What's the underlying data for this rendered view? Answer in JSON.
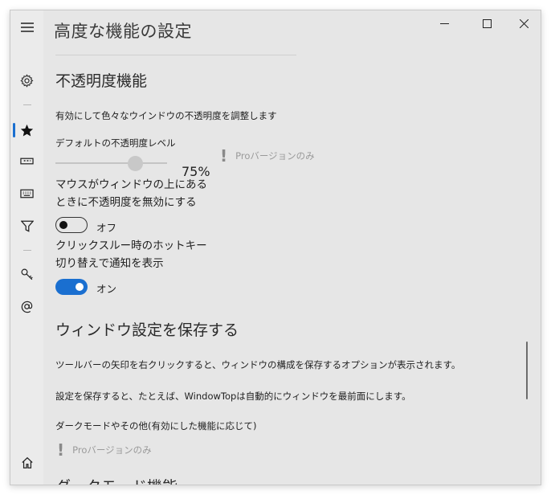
{
  "page": {
    "title": "高度な機能の設定"
  },
  "sidebar": {
    "items": [
      {
        "icon": "menu-icon"
      },
      {
        "icon": "gear-icon"
      },
      {
        "icon": "star-icon",
        "active": true
      },
      {
        "icon": "ruler-icon"
      },
      {
        "icon": "keyboard-icon"
      },
      {
        "icon": "filter-icon"
      },
      {
        "icon": "key-icon"
      },
      {
        "icon": "at-sign-icon"
      },
      {
        "icon": "home-icon"
      }
    ]
  },
  "window_controls": {
    "minimize": "minimize-icon",
    "maximize": "maximize-icon",
    "close": "close-icon"
  },
  "opacity_section": {
    "heading": "不透明度機能",
    "description": "有効にして色々なウインドウの不透明度を調整します",
    "default_level_label": "デフォルトの不透明度レベル",
    "default_level_value": "75%",
    "slider_fraction": 0.75,
    "pro_only": "Proバージョンのみ",
    "mouse_over_line1": "マウスがウィンドウの上にある",
    "mouse_over_line2": "ときに不透明度を無効にする",
    "mouse_over_toggle": "オフ",
    "hotkey_line1": "クリックスルー時のホットキー",
    "hotkey_line2": "切り替えで通知を表示",
    "hotkey_toggle": "オン"
  },
  "save_section": {
    "heading": "ウィンドウ設定を保存する",
    "text1": "ツールバーの矢印を右クリックすると、ウィンドウの構成を保存するオプションが表示されます。",
    "text2": "設定を保存すると、たとえば、WindowTopは自動的にウィンドウを最前面にします。",
    "text3": "ダークモードやその他(有効にした機能に応じて)",
    "pro_only": "Proバージョンのみ"
  },
  "next_section": {
    "heading": "ダークモード機能"
  },
  "colors": {
    "accent": "#1a6fd0",
    "background": "#e6e6e6"
  }
}
